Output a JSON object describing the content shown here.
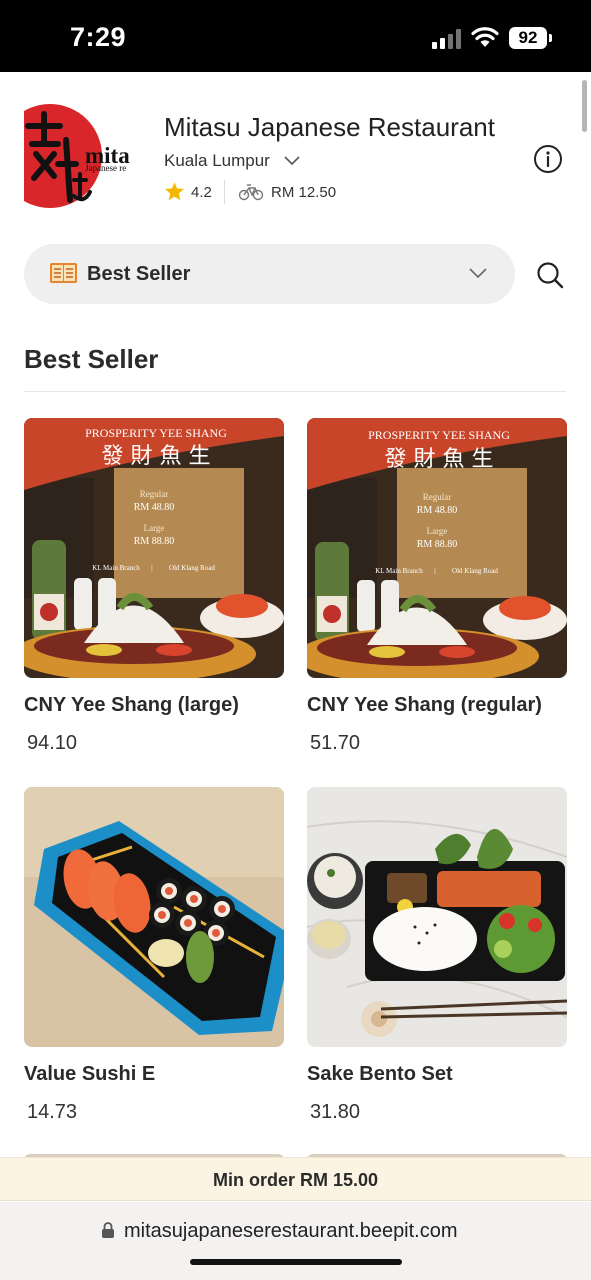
{
  "status_bar": {
    "time": "7:29",
    "battery": "92"
  },
  "restaurant": {
    "name": "Mitasu Japanese Restaurant",
    "location": "Kuala Lumpur",
    "rating": "4.2",
    "delivery_fee": "RM 12.50",
    "logo_text": "mita",
    "logo_subtext": "Japanese re"
  },
  "category_selector": {
    "label": "Best Seller",
    "icon": "menu-book-icon"
  },
  "section": {
    "title": "Best Seller"
  },
  "promo": {
    "title": "PROSPERITY YEE SHANG",
    "chinese": "發 財 魚 生",
    "regular_label": "Regular",
    "regular_price": "RM 48.80",
    "large_label": "Large",
    "large_price": "RM 88.80",
    "branch_1": "KL Main Branch",
    "branch_sep": "|",
    "branch_2": "Old Klang Road"
  },
  "products": [
    {
      "name": "CNY Yee Shang (large)",
      "price": "94.10"
    },
    {
      "name": "CNY Yee Shang (regular)",
      "price": "51.70"
    },
    {
      "name": "Value Sushi E",
      "price": "14.73"
    },
    {
      "name": "Sake Bento Set",
      "price": "31.80"
    }
  ],
  "min_order": "Min order RM 15.00",
  "browser": {
    "url": "mitasujapaneserestaurant.beepit.com"
  },
  "colors": {
    "accent_star": "#f5b800",
    "min_bar_bg": "#fbf4e2",
    "promo_red": "#c8452a"
  }
}
